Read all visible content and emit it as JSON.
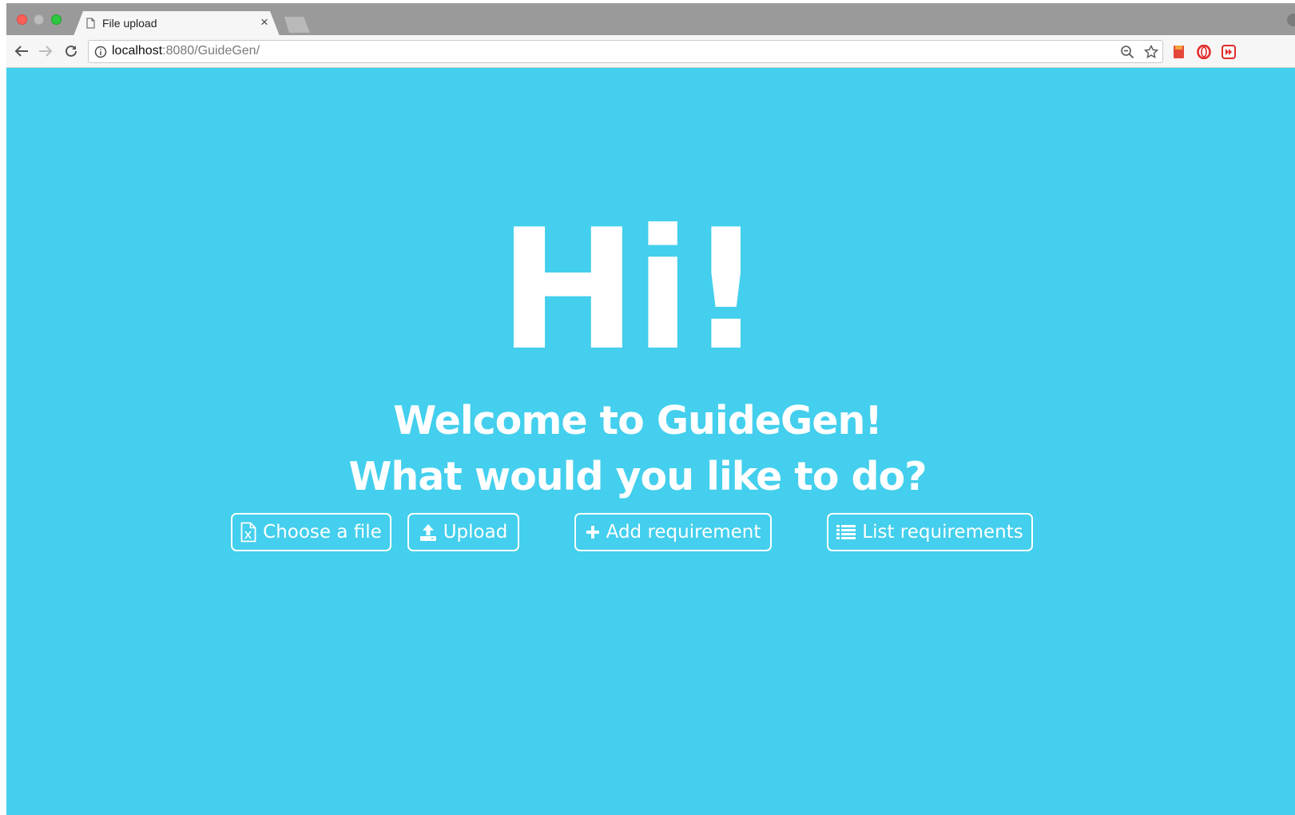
{
  "browser": {
    "tab": {
      "title": "File upload",
      "close": "×"
    },
    "address": {
      "host": "localhost",
      "path": ":8080/GuideGen/"
    }
  },
  "page": {
    "background": "#43cfed",
    "greeting": "Hi!",
    "welcome": "Welcome to GuideGen!",
    "question": "What would you like to do?",
    "buttons": {
      "choose_file": "Choose a file",
      "upload": "Upload",
      "add_requirement": "Add requirement",
      "list_requirements": "List requirements"
    }
  },
  "icons": [
    "document-icon",
    "info-icon",
    "zoom-out-icon",
    "star-icon",
    "bookmark-extension-icon",
    "opera-extension-icon",
    "media-extension-icon",
    "excel-file-icon",
    "upload-icon",
    "plus-icon",
    "list-icon"
  ]
}
